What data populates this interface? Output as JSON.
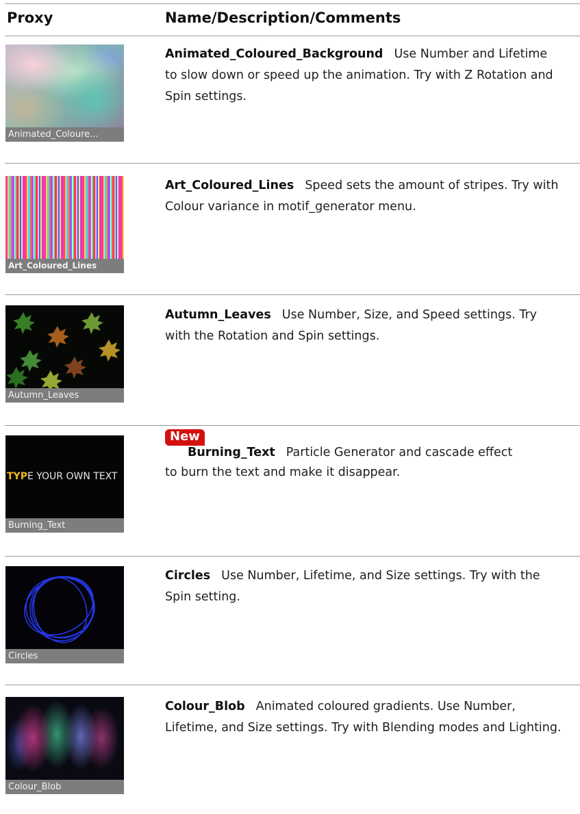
{
  "header": {
    "col_proxy": "Proxy",
    "col_desc": "Name/Description/Comments"
  },
  "rows": [
    {
      "caption": "Animated_Coloure...",
      "name": "Animated_Coloured_Background",
      "description_line1": "Use Number and Lifetime",
      "description_rest": "to slow down or speed up the animation. Try with Z Rotation and Spin settings."
    },
    {
      "caption": "Art_Coloured_Lines",
      "name": "Art_Coloured_Lines",
      "description": "Speed sets the amount of stripes. Try with Colour variance in motif_generator menu."
    },
    {
      "caption": "Autumn_Leaves",
      "name": "Autumn_Leaves",
      "description": "Use Number, Size, and Speed settings. Try with the Rotation and Spin settings."
    },
    {
      "caption": "Burning_Text",
      "badge": "New",
      "thumb_text_highlight": "TYP",
      "thumb_text_rest": "E YOUR OWN TEXT",
      "name": "Burning_Text",
      "description": "Particle Generator and cascade effect",
      "description_rest": "to burn the text and make it disappear."
    },
    {
      "caption": "Circles",
      "name": "Circles",
      "description": "Use Number, Lifetime, and Size settings. Try with the Spin setting."
    },
    {
      "caption": "Colour_Blob",
      "name": "Colour_Blob",
      "description": "Animated coloured gradients. Use Number, Lifetime, and Size settings. Try with Blending modes and Lighting."
    }
  ],
  "colors": {
    "rule": "#9a9a9a",
    "caption_bar": "#7d7d7d",
    "badge": "#d40f0f"
  }
}
